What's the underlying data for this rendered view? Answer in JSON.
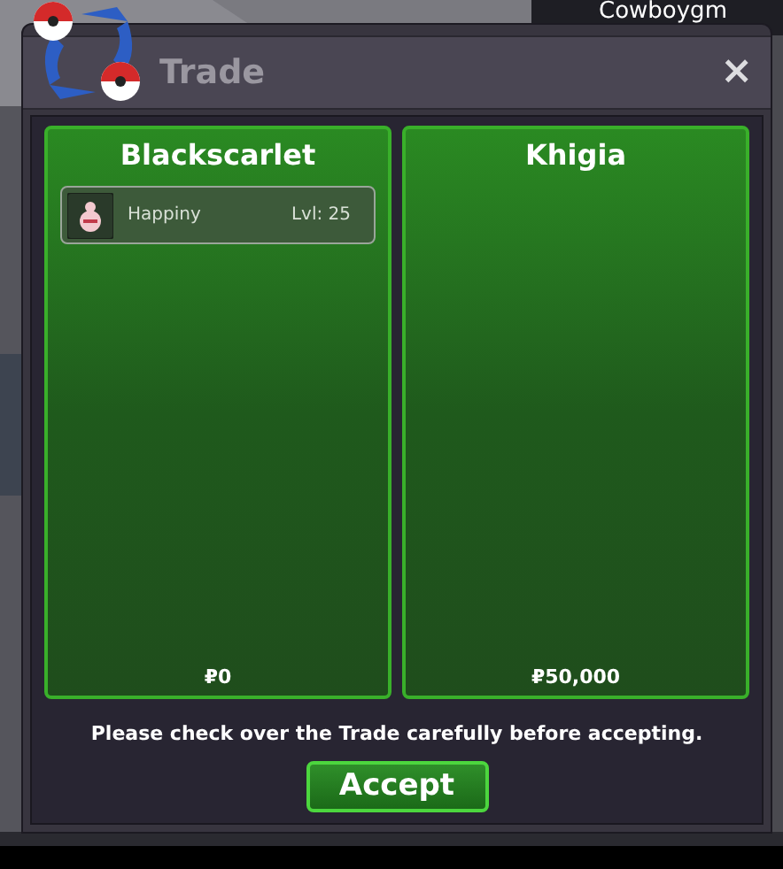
{
  "background": {
    "player_label": "Cowboygm"
  },
  "window": {
    "title": "Trade",
    "close": "×"
  },
  "panels": [
    {
      "trader": "Blackscarlet",
      "items": [
        {
          "name": "Happiny",
          "level": "Lvl: 25"
        }
      ],
      "money": "₽0"
    },
    {
      "trader": "Khigia",
      "money": "₽50,000"
    }
  ],
  "notice": "Please check over the Trade carefully before accepting.",
  "accept_button": "Accept"
}
